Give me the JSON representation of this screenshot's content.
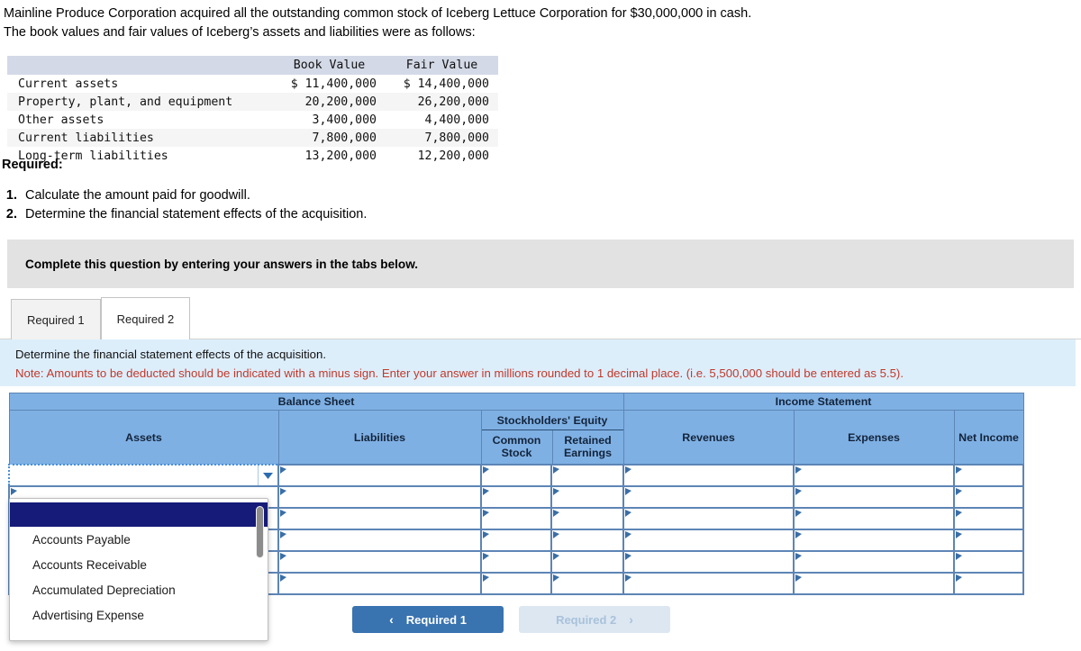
{
  "problem": {
    "line1": "Mainline Produce Corporation acquired all the outstanding common stock of Iceberg Lettuce Corporation for $30,000,000 in cash.",
    "line2": "The book values and fair values of Iceberg’s assets and liabilities were as follows:"
  },
  "value_table": {
    "headers": [
      "",
      "Book Value",
      "Fair Value"
    ],
    "rows": [
      {
        "label": "Current assets",
        "book": "$ 11,400,000",
        "fair": "$ 14,400,000"
      },
      {
        "label": "Property, plant, and equipment",
        "book": "20,200,000",
        "fair": "26,200,000"
      },
      {
        "label": "Other assets",
        "book": "3,400,000",
        "fair": "4,400,000"
      },
      {
        "label": "Current liabilities",
        "book": "7,800,000",
        "fair": "7,800,000"
      },
      {
        "label": "Long-term liabilities",
        "book": "13,200,000",
        "fair": "12,200,000"
      }
    ]
  },
  "required": {
    "heading": "Required:",
    "items": [
      {
        "num": "1.",
        "text": "Calculate the amount paid for goodwill."
      },
      {
        "num": "2.",
        "text": "Determine the financial statement effects of the acquisition."
      }
    ]
  },
  "banner": {
    "text": "Complete this question by entering your answers in the tabs below."
  },
  "tabs": [
    {
      "label": "Required 1",
      "active": false
    },
    {
      "label": "Required 2",
      "active": true
    }
  ],
  "instruction": {
    "line1": "Determine the financial statement effects of the acquisition.",
    "note": "Note: Amounts to be deducted should be indicated with a minus sign. Enter your answer in millions rounded to 1 decimal place. (i.e. 5,500,000 should be entered as 5.5)."
  },
  "grid": {
    "group_headers": [
      {
        "label": "Balance Sheet"
      },
      {
        "label": "Income Statement"
      }
    ],
    "columns": [
      {
        "label": "Assets"
      },
      {
        "label": "Liabilities"
      },
      {
        "label": "Stockholders' Equity",
        "sub": [
          "Common Stock",
          "Retained Earnings"
        ]
      },
      {
        "label": "Revenues"
      },
      {
        "label": "Expenses"
      },
      {
        "label": "Net Income"
      }
    ],
    "stockholders_equity_label": "Stockholders' Equity",
    "common_stock_label": "Common Stock",
    "retained_earnings_label": "Retained Earnings",
    "row_count": 6,
    "rows": [
      {
        "assets": "",
        "liabilities": "",
        "common_stock": "",
        "retained_earnings": "",
        "revenues": "",
        "expenses": "",
        "net_income": ""
      },
      {
        "assets": "",
        "liabilities": "",
        "common_stock": "",
        "retained_earnings": "",
        "revenues": "",
        "expenses": "",
        "net_income": ""
      },
      {
        "assets": "",
        "liabilities": "",
        "common_stock": "",
        "retained_earnings": "",
        "revenues": "",
        "expenses": "",
        "net_income": ""
      },
      {
        "assets": "",
        "liabilities": "",
        "common_stock": "",
        "retained_earnings": "",
        "revenues": "",
        "expenses": "",
        "net_income": ""
      },
      {
        "assets": "",
        "liabilities": "",
        "common_stock": "",
        "retained_earnings": "",
        "revenues": "",
        "expenses": "",
        "net_income": ""
      },
      {
        "assets": "",
        "liabilities": "",
        "common_stock": "",
        "retained_earnings": "",
        "revenues": "",
        "expenses": "",
        "net_income": ""
      }
    ]
  },
  "dropdown": {
    "selected_value": "",
    "options": [
      "",
      "Accounts Payable",
      "Accounts Receivable",
      "Accumulated Depreciation",
      "Advertising Expense"
    ]
  },
  "nav": {
    "prev_label": "Required 1",
    "prev_chevron": "‹",
    "next_label": "Required 2",
    "next_chevron": "›"
  },
  "colors": {
    "header_blue": "#7fb0e4",
    "grid_border": "#5d85b5",
    "instruction_panel": "#ddeefb",
    "note_red": "#c0392b",
    "banner_gray": "#e2e2e2",
    "primary_button": "#3973b0",
    "muted_button": "#dce7f2",
    "dropdown_selected": "#161a78"
  }
}
